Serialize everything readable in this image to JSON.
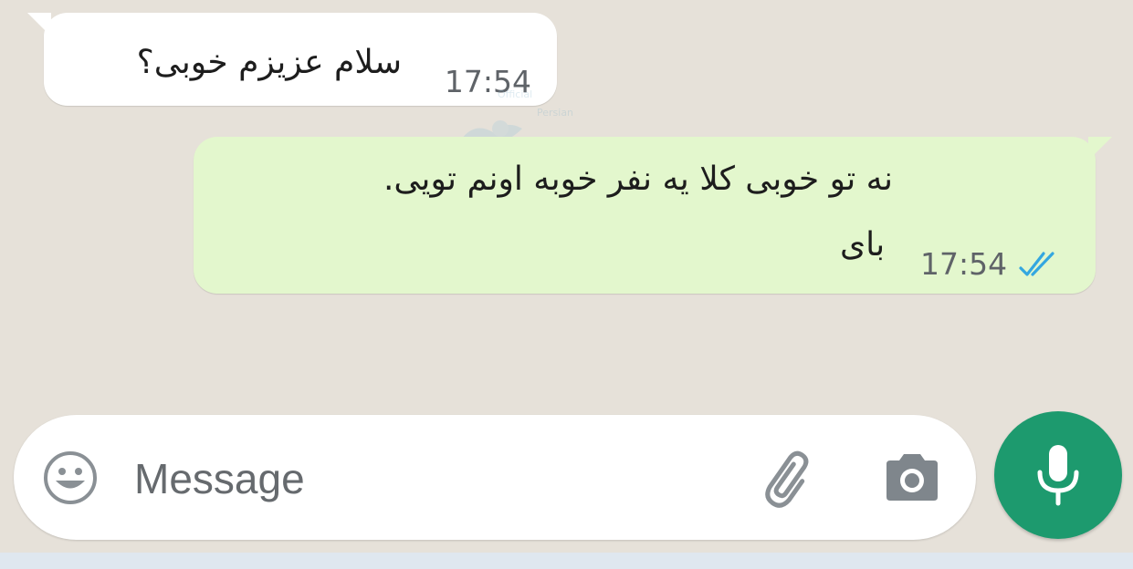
{
  "messages": [
    {
      "direction": "incoming",
      "lines": [
        "سلام عزیزم خوبی؟"
      ],
      "time": "17:54"
    },
    {
      "direction": "outgoing",
      "lines": [
        "نه تو خوبی  کلا یه نفر خوبه اونم تویی.",
        "بای"
      ],
      "time": "17:54",
      "status_icon": "double-check-read-icon"
    }
  ],
  "watermark": {
    "line1": "Official",
    "line2": "Persian"
  },
  "composer": {
    "placeholder": "Message",
    "emoji_icon": "smiley-emoji-icon",
    "attach_icon": "paperclip-icon",
    "camera_icon": "camera-icon",
    "mic_icon": "microphone-icon"
  },
  "colors": {
    "chat_background": "#e6e1d9",
    "incoming_bubble": "#ffffff",
    "outgoing_bubble": "#e3f7cd",
    "mic_button": "#1d9a6e",
    "read_ticks": "#34a7e0",
    "icon_gray": "#8a9095"
  }
}
